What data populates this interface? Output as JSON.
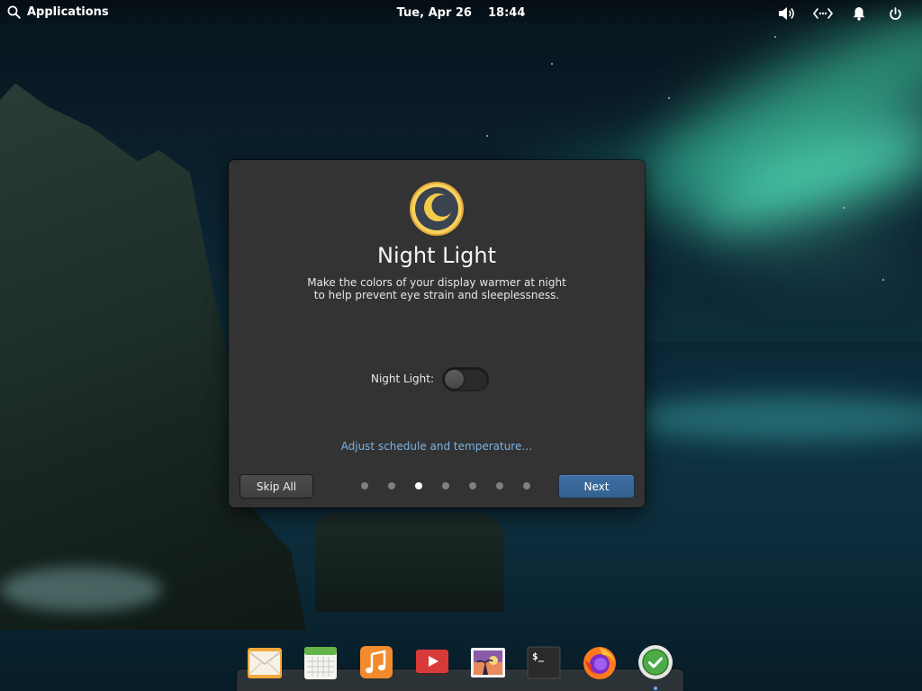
{
  "panel": {
    "applications_label": "Applications",
    "date": "Tue, Apr 26",
    "time": "18:44",
    "indicators": [
      "volume-icon",
      "network-icon",
      "notifications-icon",
      "power-icon"
    ]
  },
  "dialog": {
    "icon": "night-light-moon-icon",
    "title": "Night Light",
    "description_line1": "Make the colors of your display warmer at night",
    "description_line2": "to help prevent eye strain and sleeplessness.",
    "setting_label": "Night Light:",
    "setting_on": false,
    "adjust_link": "Adjust schedule and temperature…",
    "skip_label": "Skip All",
    "next_label": "Next",
    "page_count": 7,
    "current_page": 3
  },
  "dock": {
    "items": [
      "mail",
      "calendar",
      "music",
      "videos",
      "photos",
      "terminal",
      "firefox",
      "appcenter"
    ],
    "running_item": "appcenter"
  },
  "colors": {
    "dialog_bg": "#333333",
    "accent_blue": "#3a6898",
    "link_blue": "#7ab3e6",
    "moon_gold": "#f1c84a"
  }
}
